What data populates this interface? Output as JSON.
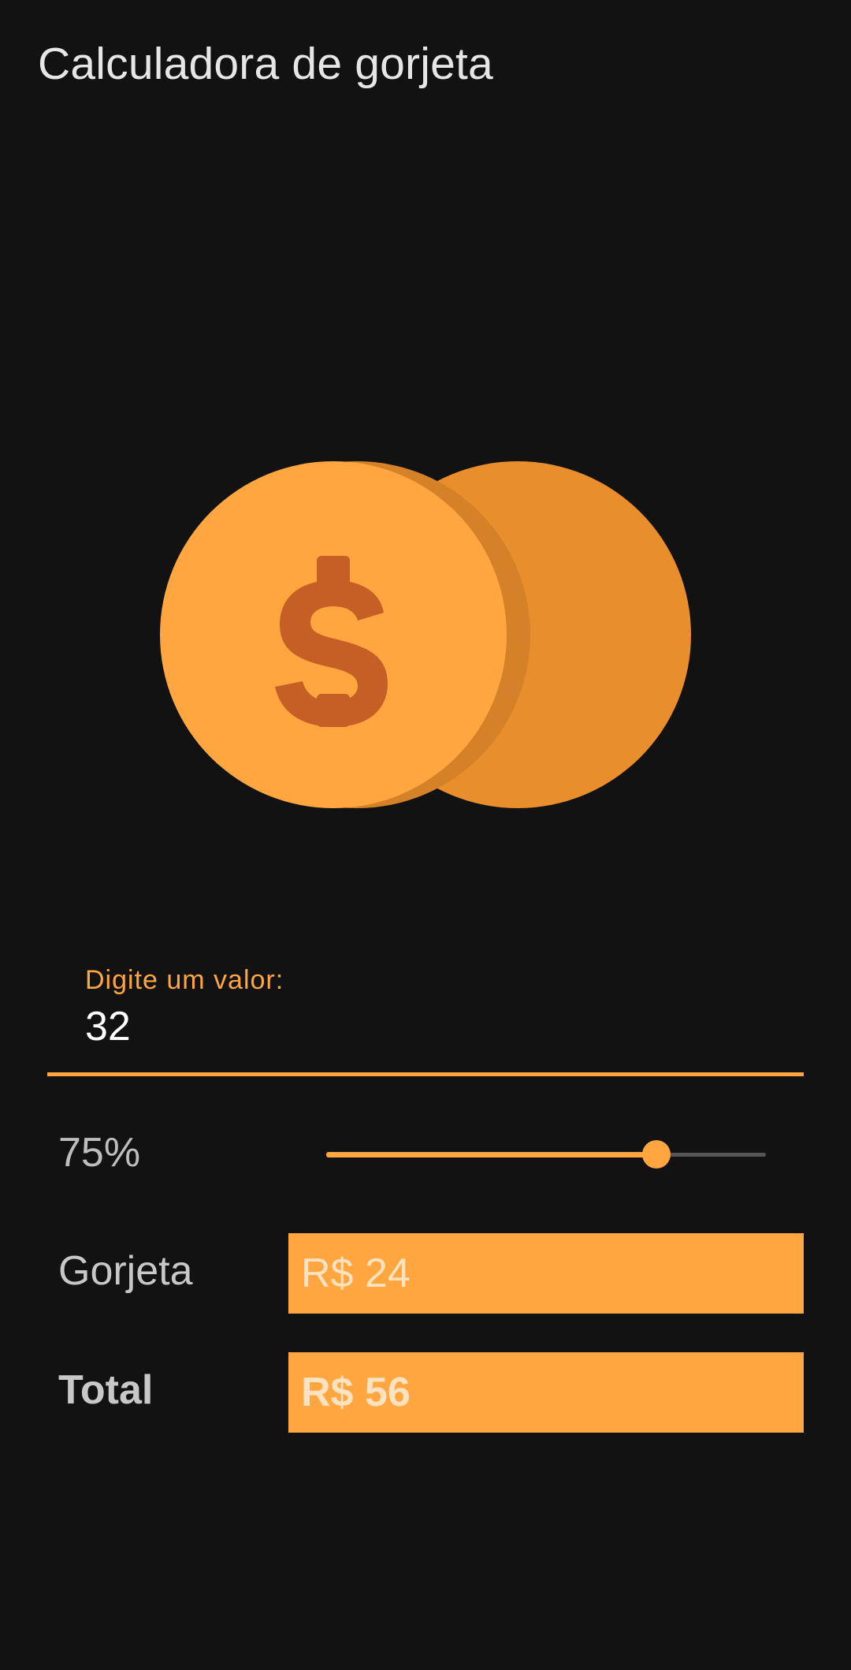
{
  "app": {
    "title": "Calculadora de gorjeta"
  },
  "illustration": {
    "icon": "coins-dollar-icon"
  },
  "input": {
    "label": "Digite um valor:",
    "value": "32"
  },
  "slider": {
    "label": "75%",
    "value_fraction": 0.75
  },
  "tip": {
    "label": "Gorjeta",
    "value": "R$ 24"
  },
  "total": {
    "label": "Total",
    "value": "R$ 56"
  },
  "colors": {
    "background": "#121212",
    "accent": "#ffa640",
    "coin_back": "#e98e2c",
    "coin_rim": "#d58128",
    "dollar": "#c55f26"
  }
}
